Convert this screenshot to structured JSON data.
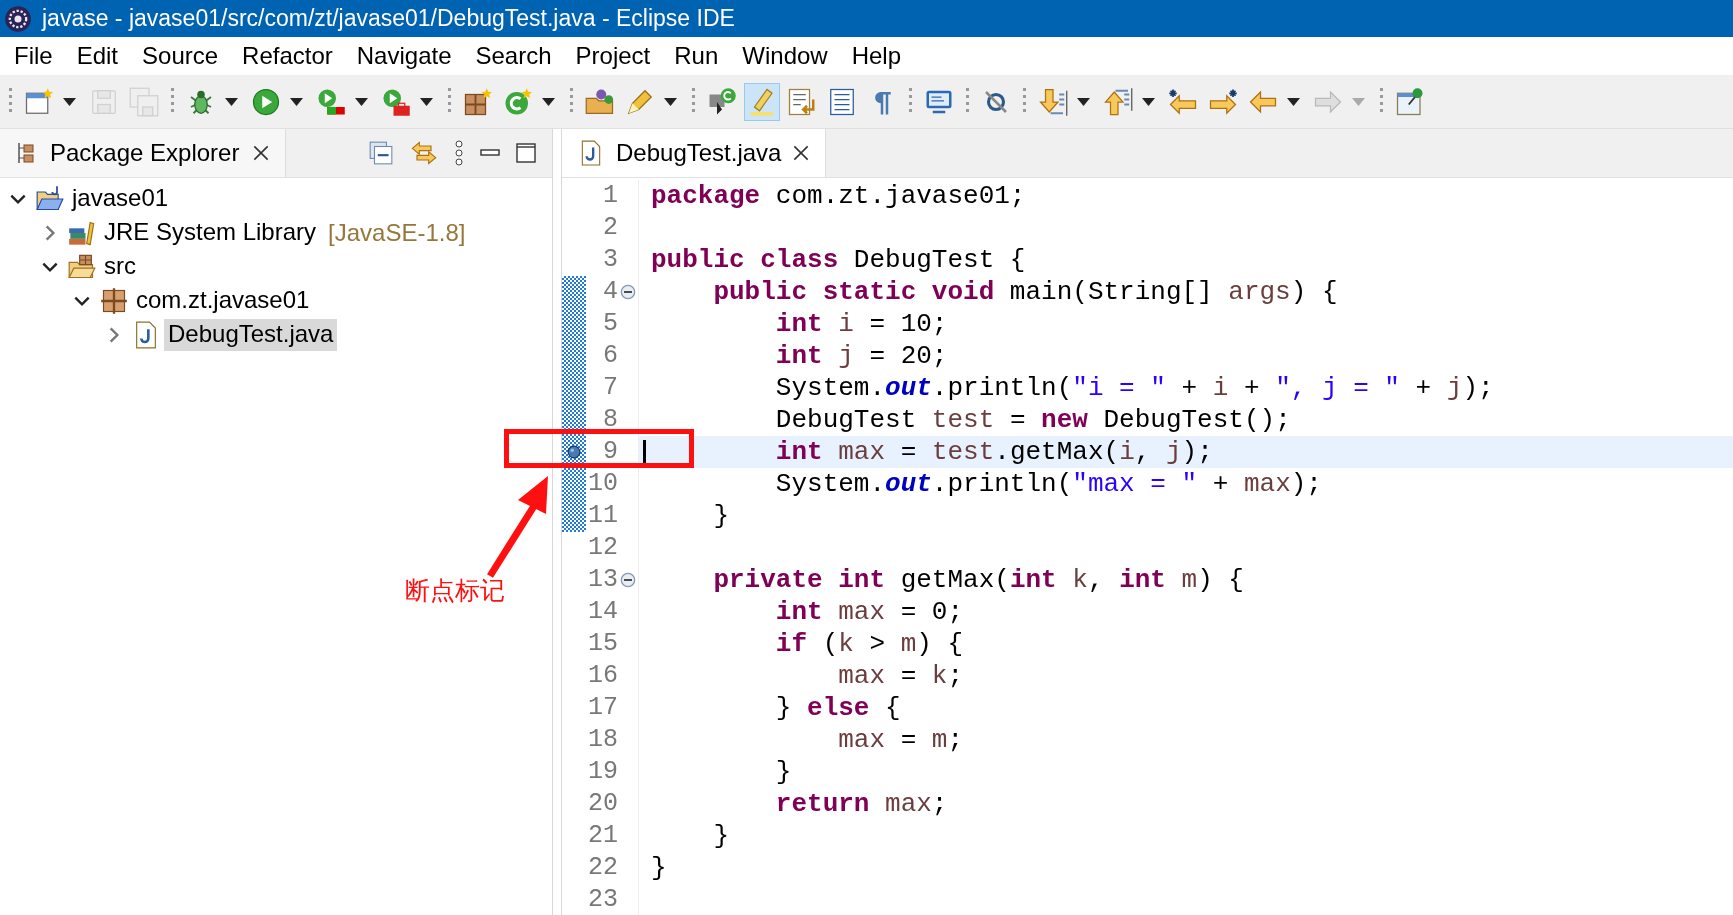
{
  "window": {
    "title": "javase - javase01/src/com/zt/javase01/DebugTest.java - Eclipse IDE"
  },
  "menu": [
    "File",
    "Edit",
    "Source",
    "Refactor",
    "Navigate",
    "Search",
    "Project",
    "Run",
    "Window",
    "Help"
  ],
  "toolbar": [
    [
      {
        "kind": "new-wizard",
        "dropdown": true,
        "disabled": false,
        "selected": false
      },
      {
        "kind": "save",
        "dropdown": false,
        "disabled": true,
        "selected": false
      },
      {
        "kind": "save-all",
        "dropdown": false,
        "disabled": true,
        "selected": false
      }
    ],
    [
      {
        "kind": "debug",
        "dropdown": true,
        "disabled": false,
        "selected": false
      },
      {
        "kind": "run",
        "dropdown": true,
        "disabled": false,
        "selected": false
      },
      {
        "kind": "coverage",
        "dropdown": true,
        "disabled": false,
        "selected": false
      },
      {
        "kind": "external-tools",
        "dropdown": true,
        "disabled": false,
        "selected": false
      }
    ],
    [
      {
        "kind": "new-package",
        "dropdown": false,
        "disabled": false,
        "selected": false
      },
      {
        "kind": "new-class",
        "dropdown": true,
        "disabled": false,
        "selected": false
      }
    ],
    [
      {
        "kind": "open-type",
        "dropdown": false,
        "disabled": false,
        "selected": false
      },
      {
        "kind": "pen",
        "dropdown": true,
        "disabled": false,
        "selected": false
      }
    ],
    [
      {
        "kind": "open-task",
        "dropdown": false,
        "disabled": false,
        "selected": false
      },
      {
        "kind": "highlight",
        "dropdown": false,
        "disabled": false,
        "selected": true
      },
      {
        "kind": "word-wrap",
        "dropdown": false,
        "disabled": false,
        "selected": false
      },
      {
        "kind": "block-select",
        "dropdown": false,
        "disabled": false,
        "selected": false
      },
      {
        "kind": "pilcrow",
        "dropdown": false,
        "disabled": false,
        "selected": false
      }
    ],
    [
      {
        "kind": "console",
        "dropdown": false,
        "disabled": false,
        "selected": false
      }
    ],
    [
      {
        "kind": "skip-breakpoints",
        "dropdown": false,
        "disabled": false,
        "selected": false
      }
    ],
    [
      {
        "kind": "next-annotation",
        "dropdown": true,
        "disabled": false,
        "selected": false
      },
      {
        "kind": "prev-annotation",
        "dropdown": true,
        "disabled": false,
        "selected": false
      },
      {
        "kind": "back-star",
        "dropdown": false,
        "disabled": false,
        "selected": false
      },
      {
        "kind": "forward-star",
        "dropdown": false,
        "disabled": false,
        "selected": false
      },
      {
        "kind": "back",
        "dropdown": true,
        "disabled": false,
        "selected": false
      },
      {
        "kind": "forward",
        "dropdown": true,
        "disabled": true,
        "selected": false
      }
    ],
    [
      {
        "kind": "pin",
        "dropdown": false,
        "disabled": false,
        "selected": false
      }
    ]
  ],
  "explorer": {
    "title": "Package Explorer",
    "tree": [
      {
        "label": "javase01",
        "kind": "project",
        "expanded": true,
        "selected": false,
        "children": [
          {
            "label": "JRE System Library",
            "decoration": "[JavaSE-1.8]",
            "kind": "library",
            "expanded": false,
            "selected": false
          },
          {
            "label": "src",
            "kind": "source-folder",
            "expanded": true,
            "selected": false,
            "children": [
              {
                "label": "com.zt.javase01",
                "kind": "package",
                "expanded": true,
                "selected": false,
                "children": [
                  {
                    "label": "DebugTest.java",
                    "kind": "java-file",
                    "expanded": false,
                    "selected": true
                  }
                ]
              }
            ]
          }
        ]
      }
    ]
  },
  "editor": {
    "tab": "DebugTest.java",
    "lines": [
      {
        "number": "1",
        "range": false,
        "breakpoint": false,
        "current": false,
        "tokens": [
          {
            "kind": "kw",
            "text": "package"
          },
          {
            "kind": "txt",
            "text": " com.zt.javase01;"
          }
        ]
      },
      {
        "number": "2",
        "range": false,
        "breakpoint": false,
        "current": false
      },
      {
        "number": "3",
        "range": false,
        "breakpoint": false,
        "current": false,
        "tokens": [
          {
            "kind": "kw",
            "text": "public class"
          },
          {
            "kind": "txt",
            "text": " DebugTest {"
          }
        ]
      },
      {
        "number": "4",
        "range": true,
        "breakpoint": false,
        "current": false,
        "folded": false,
        "tokens": [
          {
            "kind": "kw",
            "text": "    public static void"
          },
          {
            "kind": "txt",
            "text": " main(String[] "
          },
          {
            "kind": "var",
            "text": "args"
          },
          {
            "kind": "txt",
            "text": ") {"
          }
        ]
      },
      {
        "number": "5",
        "range": true,
        "breakpoint": false,
        "current": false,
        "tokens": [
          {
            "kind": "kw",
            "text": "        int"
          },
          {
            "kind": "var",
            "text": " i"
          },
          {
            "kind": "txt",
            "text": " = 10;"
          }
        ]
      },
      {
        "number": "6",
        "range": true,
        "breakpoint": false,
        "current": false,
        "tokens": [
          {
            "kind": "kw",
            "text": "        int"
          },
          {
            "kind": "var",
            "text": " j"
          },
          {
            "kind": "txt",
            "text": " = 20;"
          }
        ]
      },
      {
        "number": "7",
        "range": true,
        "breakpoint": false,
        "current": false,
        "tokens": [
          {
            "kind": "txt",
            "text": "        System."
          },
          {
            "kind": "field",
            "text": "out"
          },
          {
            "kind": "txt",
            "text": ".println("
          },
          {
            "kind": "str",
            "text": "\"i = \""
          },
          {
            "kind": "txt",
            "text": " + "
          },
          {
            "kind": "var",
            "text": "i"
          },
          {
            "kind": "txt",
            "text": " + "
          },
          {
            "kind": "str",
            "text": "\", j = \""
          },
          {
            "kind": "txt",
            "text": " + "
          },
          {
            "kind": "var",
            "text": "j"
          },
          {
            "kind": "txt",
            "text": ");"
          }
        ]
      },
      {
        "number": "8",
        "range": true,
        "breakpoint": false,
        "current": false,
        "tokens": [
          {
            "kind": "txt",
            "text": "        DebugTest "
          },
          {
            "kind": "var",
            "text": "test"
          },
          {
            "kind": "txt",
            "text": " = "
          },
          {
            "kind": "kw",
            "text": "new"
          },
          {
            "kind": "txt",
            "text": " DebugTest();"
          }
        ]
      },
      {
        "number": "9",
        "range": true,
        "breakpoint": true,
        "current": true,
        "tokens": [
          {
            "kind": "kw",
            "text": "        int"
          },
          {
            "kind": "var",
            "text": " max"
          },
          {
            "kind": "txt",
            "text": " = "
          },
          {
            "kind": "var",
            "text": "test"
          },
          {
            "kind": "txt",
            "text": ".getMax("
          },
          {
            "kind": "var",
            "text": "i"
          },
          {
            "kind": "txt",
            "text": ", "
          },
          {
            "kind": "var",
            "text": "j"
          },
          {
            "kind": "txt",
            "text": ");"
          }
        ]
      },
      {
        "number": "10",
        "range": true,
        "breakpoint": false,
        "current": false,
        "tokens": [
          {
            "kind": "txt",
            "text": "        System."
          },
          {
            "kind": "field",
            "text": "out"
          },
          {
            "kind": "txt",
            "text": ".println("
          },
          {
            "kind": "str",
            "text": "\"max = \""
          },
          {
            "kind": "txt",
            "text": " + "
          },
          {
            "kind": "var",
            "text": "max"
          },
          {
            "kind": "txt",
            "text": ");"
          }
        ]
      },
      {
        "number": "11",
        "range": true,
        "breakpoint": false,
        "current": false,
        "tokens": [
          {
            "kind": "txt",
            "text": "    }"
          }
        ]
      },
      {
        "number": "12",
        "range": false,
        "breakpoint": false,
        "current": false
      },
      {
        "number": "13",
        "range": false,
        "breakpoint": false,
        "current": false,
        "folded": false,
        "tokens": [
          {
            "kind": "kw",
            "text": "    private int"
          },
          {
            "kind": "txt",
            "text": " getMax("
          },
          {
            "kind": "kw",
            "text": "int"
          },
          {
            "kind": "var",
            "text": " k"
          },
          {
            "kind": "txt",
            "text": ", "
          },
          {
            "kind": "kw",
            "text": "int"
          },
          {
            "kind": "var",
            "text": " m"
          },
          {
            "kind": "txt",
            "text": ") {"
          }
        ]
      },
      {
        "number": "14",
        "range": false,
        "breakpoint": false,
        "current": false,
        "tokens": [
          {
            "kind": "kw",
            "text": "        int"
          },
          {
            "kind": "var",
            "text": " max"
          },
          {
            "kind": "txt",
            "text": " = 0;"
          }
        ]
      },
      {
        "number": "15",
        "range": false,
        "breakpoint": false,
        "current": false,
        "tokens": [
          {
            "kind": "kw",
            "text": "        if"
          },
          {
            "kind": "txt",
            "text": " ("
          },
          {
            "kind": "var",
            "text": "k"
          },
          {
            "kind": "txt",
            "text": " > "
          },
          {
            "kind": "var",
            "text": "m"
          },
          {
            "kind": "txt",
            "text": ") {"
          }
        ]
      },
      {
        "number": "16",
        "range": false,
        "breakpoint": false,
        "current": false,
        "tokens": [
          {
            "kind": "var",
            "text": "            max"
          },
          {
            "kind": "txt",
            "text": " = "
          },
          {
            "kind": "var",
            "text": "k"
          },
          {
            "kind": "txt",
            "text": ";"
          }
        ]
      },
      {
        "number": "17",
        "range": false,
        "breakpoint": false,
        "current": false,
        "tokens": [
          {
            "kind": "txt",
            "text": "        } "
          },
          {
            "kind": "kw",
            "text": "else"
          },
          {
            "kind": "txt",
            "text": " {"
          }
        ]
      },
      {
        "number": "18",
        "range": false,
        "breakpoint": false,
        "current": false,
        "tokens": [
          {
            "kind": "var",
            "text": "            max"
          },
          {
            "kind": "txt",
            "text": " = "
          },
          {
            "kind": "var",
            "text": "m"
          },
          {
            "kind": "txt",
            "text": ";"
          }
        ]
      },
      {
        "number": "19",
        "range": false,
        "breakpoint": false,
        "current": false,
        "tokens": [
          {
            "kind": "txt",
            "text": "        }"
          }
        ]
      },
      {
        "number": "20",
        "range": false,
        "breakpoint": false,
        "current": false,
        "tokens": [
          {
            "kind": "kw",
            "text": "        return"
          },
          {
            "kind": "var",
            "text": " max"
          },
          {
            "kind": "txt",
            "text": ";"
          }
        ]
      },
      {
        "number": "21",
        "range": false,
        "breakpoint": false,
        "current": false,
        "tokens": [
          {
            "kind": "txt",
            "text": "    }"
          }
        ]
      },
      {
        "number": "22",
        "range": false,
        "breakpoint": false,
        "current": false,
        "tokens": [
          {
            "kind": "txt",
            "text": "}"
          }
        ]
      },
      {
        "number": "23",
        "range": false,
        "breakpoint": false,
        "current": false
      }
    ]
  },
  "annotation": {
    "label": "断点标记"
  }
}
